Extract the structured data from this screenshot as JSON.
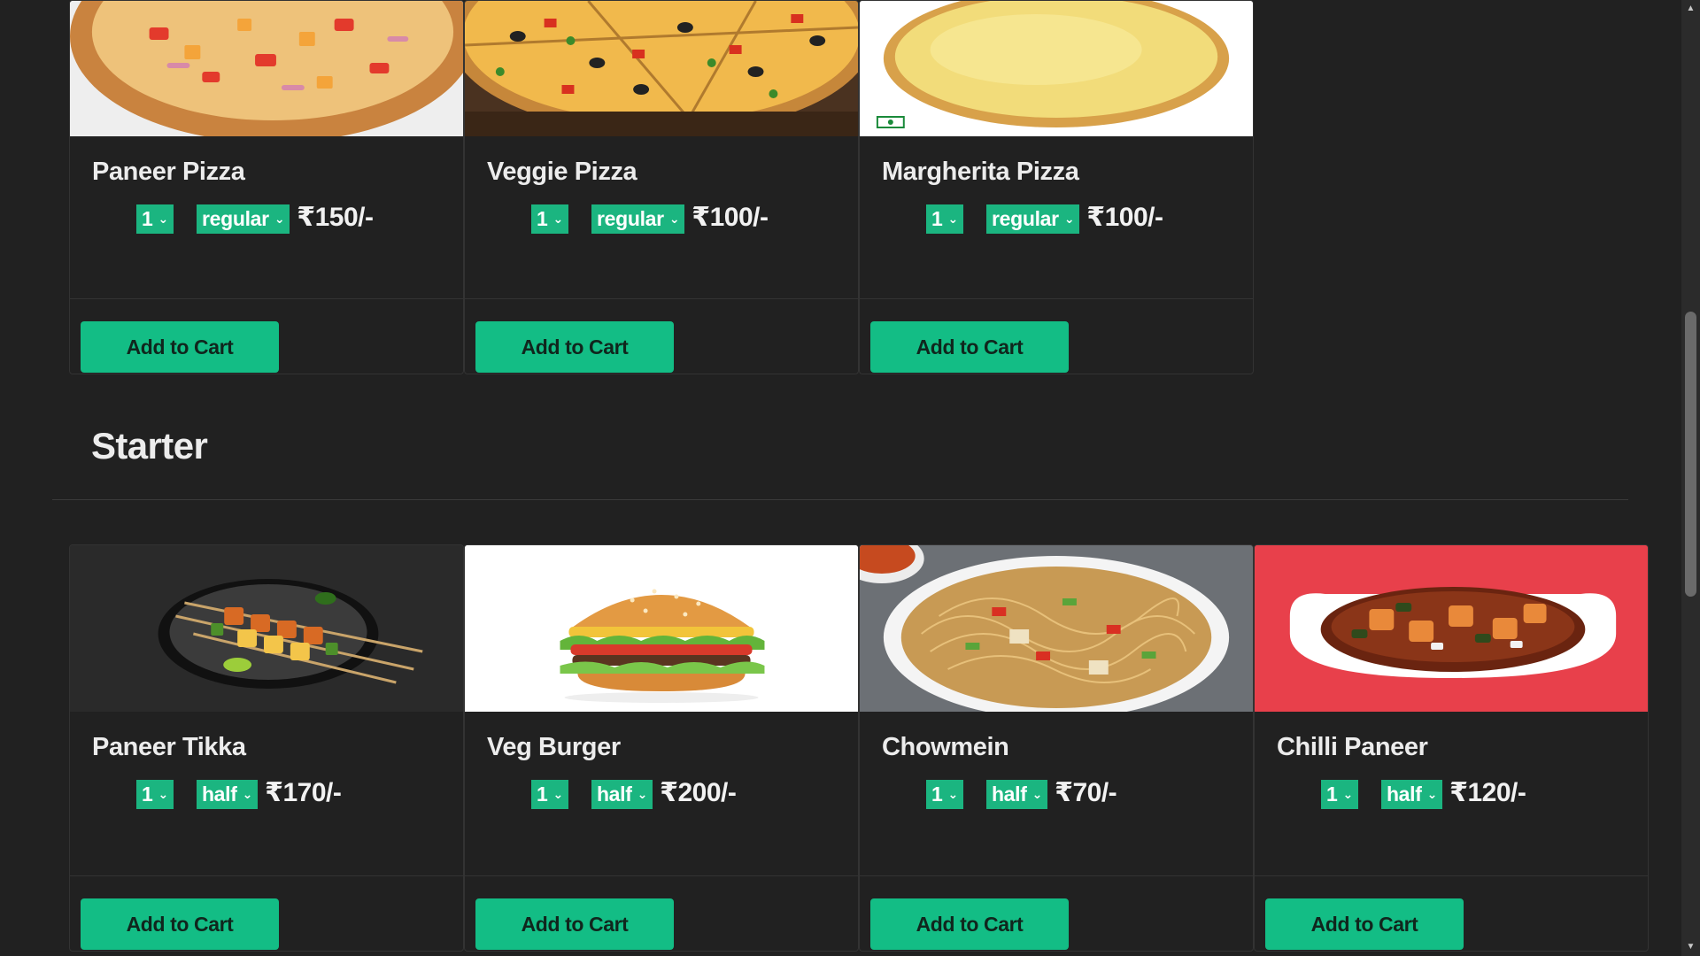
{
  "sections": [
    {
      "id": "pizza",
      "title": "",
      "items": [
        {
          "name": "Paneer Pizza",
          "qty": "1",
          "size": "regular",
          "price": "₹150/-",
          "button": "Add to Cart"
        },
        {
          "name": "Veggie Pizza",
          "qty": "1",
          "size": "regular",
          "price": "₹100/-",
          "button": "Add to Cart"
        },
        {
          "name": "Margherita Pizza",
          "qty": "1",
          "size": "regular",
          "price": "₹100/-",
          "button": "Add to Cart"
        }
      ]
    },
    {
      "id": "starter",
      "title": "Starter",
      "items": [
        {
          "name": "Paneer Tikka",
          "qty": "1",
          "size": "half",
          "price": "₹170/-",
          "button": "Add to Cart"
        },
        {
          "name": "Veg Burger",
          "qty": "1",
          "size": "half",
          "price": "₹200/-",
          "button": "Add to Cart"
        },
        {
          "name": "Chowmein",
          "qty": "1",
          "size": "half",
          "price": "₹70/-",
          "button": "Add to Cart"
        },
        {
          "name": "Chilli Paneer",
          "qty": "1",
          "size": "half",
          "price": "₹120/-",
          "button": "Add to Cart"
        }
      ]
    }
  ],
  "icons": {
    "select_chevron": "chevron-down-icon",
    "veg_mark": "veg-mark-icon"
  },
  "colors": {
    "background": "#212121",
    "accent": "#13bd85",
    "select": "#1bb580",
    "text": "#ececec"
  }
}
